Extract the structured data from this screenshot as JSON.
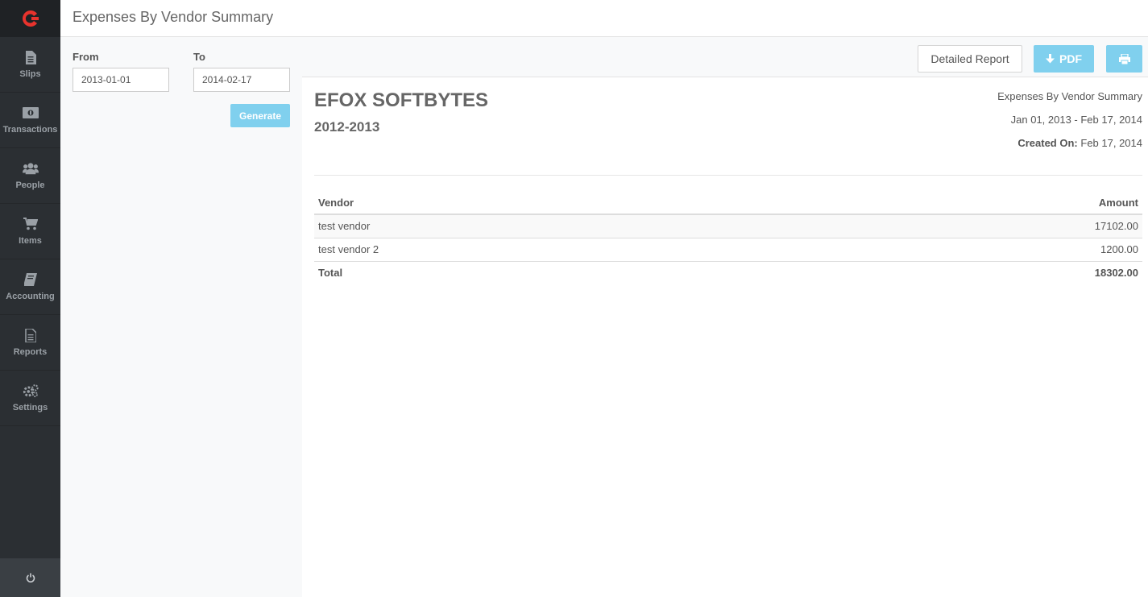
{
  "header": {
    "title": "Expenses By Vendor Summary"
  },
  "sidebar": {
    "items": [
      {
        "label": "Slips",
        "icon": "file-icon"
      },
      {
        "label": "Transactions",
        "icon": "money-icon"
      },
      {
        "label": "People",
        "icon": "users-icon"
      },
      {
        "label": "Items",
        "icon": "cart-icon"
      },
      {
        "label": "Accounting",
        "icon": "book-icon"
      },
      {
        "label": "Reports",
        "icon": "report-icon"
      },
      {
        "label": "Settings",
        "icon": "gears-icon"
      }
    ]
  },
  "filter": {
    "from_label": "From",
    "from_value": "2013-01-01",
    "to_label": "To",
    "to_value": "2014-02-17",
    "generate_label": "Generate"
  },
  "toolbar": {
    "detailed_label": "Detailed Report",
    "pdf_label": "PDF"
  },
  "report": {
    "company": "EFOX SOFTBYTES",
    "period": "2012-2013",
    "title": "Expenses By Vendor Summary",
    "range": "Jan 01, 2013 - Feb 17, 2014",
    "created_label": "Created On:",
    "created_value": "Feb 17, 2014",
    "columns": [
      "Vendor",
      "Amount"
    ],
    "rows": [
      {
        "vendor": "test vendor",
        "amount": "17102.00"
      },
      {
        "vendor": "test vendor 2",
        "amount": "1200.00"
      }
    ],
    "total_label": "Total",
    "total_value": "18302.00"
  },
  "colors": {
    "accent": "#80d0ee",
    "brand": "#e8332d",
    "sidebar": "#2b2f33"
  }
}
